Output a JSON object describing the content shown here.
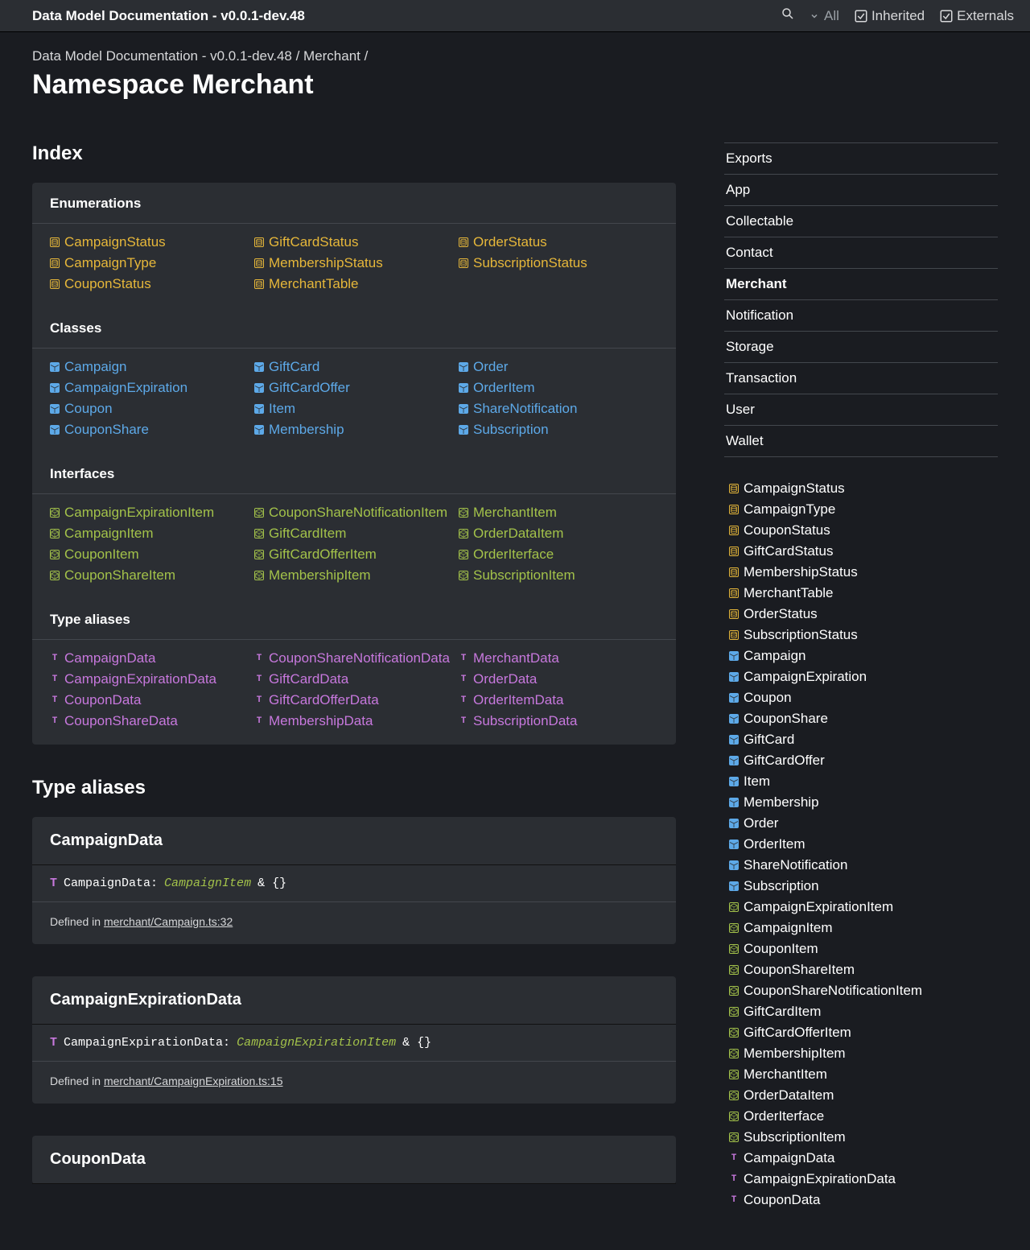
{
  "topbar": {
    "title": "Data Model Documentation - v0.0.1-dev.48",
    "filter_label": "All",
    "inherited_label": "Inherited",
    "externals_label": "Externals"
  },
  "breadcrumb": {
    "root": "Data Model Documentation - v0.0.1-dev.48",
    "sep": " / ",
    "parent": "Merchant",
    "trail": " /"
  },
  "page_title": "Namespace Merchant",
  "index_heading": "Index",
  "groups": {
    "enumerations": {
      "heading": "Enumerations",
      "cols": [
        [
          "CampaignStatus",
          "CampaignType",
          "CouponStatus"
        ],
        [
          "GiftCardStatus",
          "MembershipStatus",
          "MerchantTable"
        ],
        [
          "OrderStatus",
          "SubscriptionStatus"
        ]
      ]
    },
    "classes": {
      "heading": "Classes",
      "cols": [
        [
          "Campaign",
          "CampaignExpiration",
          "Coupon",
          "CouponShare"
        ],
        [
          "GiftCard",
          "GiftCardOffer",
          "Item",
          "Membership"
        ],
        [
          "Order",
          "OrderItem",
          "ShareNotification",
          "Subscription"
        ]
      ]
    },
    "interfaces": {
      "heading": "Interfaces",
      "cols": [
        [
          "CampaignExpirationItem",
          "CampaignItem",
          "CouponItem",
          "CouponShareItem"
        ],
        [
          "CouponShareNotificationItem",
          "GiftCardItem",
          "GiftCardOfferItem",
          "MembershipItem"
        ],
        [
          "MerchantItem",
          "OrderDataItem",
          "OrderIterface",
          "SubscriptionItem"
        ]
      ]
    },
    "type_aliases": {
      "heading": "Type aliases",
      "cols": [
        [
          "CampaignData",
          "CampaignExpirationData",
          "CouponData",
          "CouponShareData"
        ],
        [
          "CouponShareNotificationData",
          "GiftCardData",
          "GiftCardOfferData",
          "MembershipData"
        ],
        [
          "MerchantData",
          "OrderData",
          "OrderItemData",
          "SubscriptionData"
        ]
      ]
    }
  },
  "type_aliases_heading": "Type aliases",
  "aliases": [
    {
      "name": "CampaignData",
      "sig_name": "CampaignData:",
      "sig_type": "CampaignItem",
      "sig_rest": "& {}",
      "defined_prefix": "Defined in ",
      "defined_file": "merchant/Campaign.ts:32"
    },
    {
      "name": "CampaignExpirationData",
      "sig_name": "CampaignExpirationData:",
      "sig_type": "CampaignExpirationItem",
      "sig_rest": "& {}",
      "defined_prefix": "Defined in ",
      "defined_file": "merchant/CampaignExpiration.ts:15"
    },
    {
      "name": "CouponData",
      "sig_name": "",
      "sig_type": "",
      "sig_rest": "",
      "defined_prefix": "",
      "defined_file": ""
    }
  ],
  "side_nav": [
    {
      "label": "Exports",
      "active": false
    },
    {
      "label": "App",
      "active": false
    },
    {
      "label": "Collectable",
      "active": false
    },
    {
      "label": "Contact",
      "active": false
    },
    {
      "label": "Merchant",
      "active": true
    },
    {
      "label": "Notification",
      "active": false
    },
    {
      "label": "Storage",
      "active": false
    },
    {
      "label": "Transaction",
      "active": false
    },
    {
      "label": "User",
      "active": false
    },
    {
      "label": "Wallet",
      "active": false
    }
  ],
  "side_list": [
    {
      "kind": "enum",
      "label": "CampaignStatus"
    },
    {
      "kind": "enum",
      "label": "CampaignType"
    },
    {
      "kind": "enum",
      "label": "CouponStatus"
    },
    {
      "kind": "enum",
      "label": "GiftCardStatus"
    },
    {
      "kind": "enum",
      "label": "MembershipStatus"
    },
    {
      "kind": "enum",
      "label": "MerchantTable"
    },
    {
      "kind": "enum",
      "label": "OrderStatus"
    },
    {
      "kind": "enum",
      "label": "SubscriptionStatus"
    },
    {
      "kind": "class",
      "label": "Campaign"
    },
    {
      "kind": "class",
      "label": "CampaignExpiration"
    },
    {
      "kind": "class",
      "label": "Coupon"
    },
    {
      "kind": "class",
      "label": "CouponShare"
    },
    {
      "kind": "class",
      "label": "GiftCard"
    },
    {
      "kind": "class",
      "label": "GiftCardOffer"
    },
    {
      "kind": "class",
      "label": "Item"
    },
    {
      "kind": "class",
      "label": "Membership"
    },
    {
      "kind": "class",
      "label": "Order"
    },
    {
      "kind": "class",
      "label": "OrderItem"
    },
    {
      "kind": "class",
      "label": "ShareNotification"
    },
    {
      "kind": "class",
      "label": "Subscription"
    },
    {
      "kind": "iface",
      "label": "CampaignExpirationItem"
    },
    {
      "kind": "iface",
      "label": "CampaignItem"
    },
    {
      "kind": "iface",
      "label": "CouponItem"
    },
    {
      "kind": "iface",
      "label": "CouponShareItem"
    },
    {
      "kind": "iface",
      "label": "CouponShareNotificationItem"
    },
    {
      "kind": "iface",
      "label": "GiftCardItem"
    },
    {
      "kind": "iface",
      "label": "GiftCardOfferItem"
    },
    {
      "kind": "iface",
      "label": "MembershipItem"
    },
    {
      "kind": "iface",
      "label": "MerchantItem"
    },
    {
      "kind": "iface",
      "label": "OrderDataItem"
    },
    {
      "kind": "iface",
      "label": "OrderIterface"
    },
    {
      "kind": "iface",
      "label": "SubscriptionItem"
    },
    {
      "kind": "type",
      "label": "CampaignData"
    },
    {
      "kind": "type",
      "label": "CampaignExpirationData"
    },
    {
      "kind": "type",
      "label": "CouponData"
    }
  ]
}
